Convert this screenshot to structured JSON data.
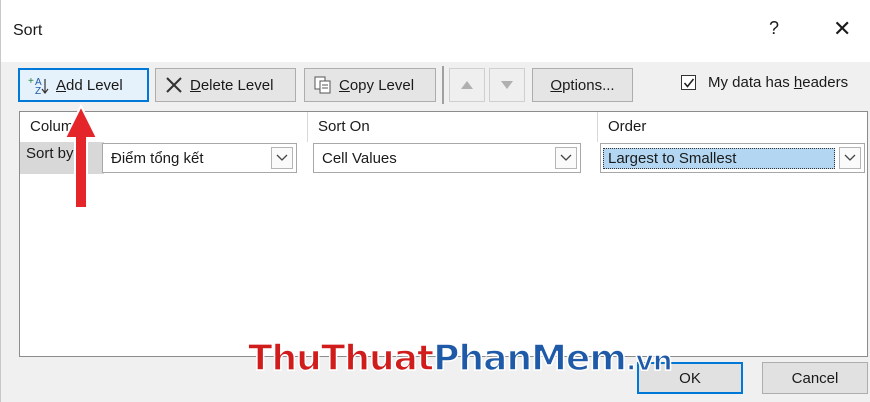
{
  "dialog": {
    "title": "Sort",
    "help_label": "?",
    "close_label": "✕"
  },
  "toolbar": {
    "add_level": {
      "prefix": "",
      "underline": "A",
      "rest": "dd Level"
    },
    "delete_level": {
      "underline": "D",
      "rest": "elete Level"
    },
    "copy_level": {
      "underline": "C",
      "rest": "opy Level"
    },
    "options": {
      "underline": "O",
      "rest": "ptions..."
    },
    "move_up_icon": "triangle-up",
    "move_down_icon": "triangle-down",
    "my_data_has_headers": {
      "prefix": "My data has ",
      "underline": "h",
      "rest": "eaders",
      "checked": true
    }
  },
  "grid": {
    "headers": [
      "Column",
      "Sort On",
      "Order"
    ],
    "header_column_visible": "Colum",
    "row_label": "Sort by",
    "rows": [
      {
        "column": "Điểm tổng kết",
        "sort_on": "Cell Values",
        "order": "Largest to Smallest"
      }
    ]
  },
  "buttons": {
    "ok": "OK",
    "cancel": "Cancel"
  },
  "watermark": {
    "part1": "ThuThuat",
    "part2": "PhanMem",
    "part3": ".vn"
  },
  "colors": {
    "accent": "#0078d7",
    "selection": "#b3d7f3",
    "arrow": "#e4262a"
  }
}
